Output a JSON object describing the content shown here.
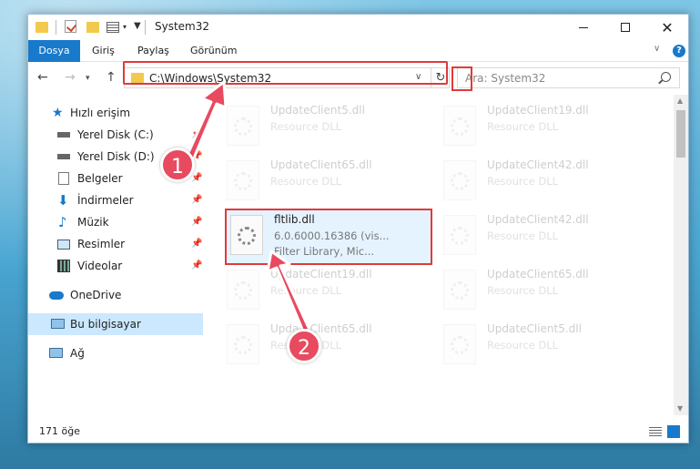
{
  "window": {
    "title": "System32",
    "controls": {
      "minimize": "—",
      "maximize": "☐",
      "close": "✕"
    }
  },
  "ribbon": {
    "tabs": [
      "Dosya",
      "Giriş",
      "Paylaş",
      "Görünüm"
    ],
    "help": "?"
  },
  "navbar": {
    "address": "C:\\Windows\\System32",
    "search_placeholder": "Ara: System32"
  },
  "sidebar": {
    "items": [
      {
        "label": "Hızlı erişim",
        "icon": "star-icon"
      },
      {
        "label": "Yerel Disk (C:)",
        "icon": "drive-icon",
        "pinned": true
      },
      {
        "label": "Yerel Disk (D:)",
        "icon": "drive-icon",
        "pinned": true
      },
      {
        "label": "Belgeler",
        "icon": "documents-icon",
        "pinned": true
      },
      {
        "label": "İndirmeler",
        "icon": "downloads-icon",
        "pinned": true
      },
      {
        "label": "Müzik",
        "icon": "music-icon",
        "pinned": true
      },
      {
        "label": "Resimler",
        "icon": "pictures-icon",
        "pinned": true
      },
      {
        "label": "Videolar",
        "icon": "videos-icon",
        "pinned": true
      },
      {
        "label": "OneDrive",
        "icon": "cloud-icon"
      },
      {
        "label": "Bu bilgisayar",
        "icon": "computer-icon",
        "selected": true
      },
      {
        "label": "Ağ",
        "icon": "network-icon"
      }
    ]
  },
  "files": [
    {
      "name": "UpdateClient5.dll",
      "desc": "Resource DLL"
    },
    {
      "name": "UpdateClient19.dll",
      "desc": "Resource DLL"
    },
    {
      "name": "UpdateClient65.dll",
      "desc": "Resource DLL"
    },
    {
      "name": "UpdateClient42.dll",
      "desc": "Resource DLL"
    },
    {
      "name": "fltlib.dll",
      "desc": "6.0.6000.16386 (vis...",
      "desc2": "Filter Library, Mic..."
    },
    {
      "name": "UpdateClient42.dll",
      "desc": "Resource DLL"
    },
    {
      "name": "UpdateClient19.dll",
      "desc": "Resource DLL"
    },
    {
      "name": "UpdateClient65.dll",
      "desc": "Resource DLL"
    },
    {
      "name": "UpdateClient65.dll",
      "desc": "Resource DLL"
    },
    {
      "name": "UpdateClient5.dll",
      "desc": "Resource DLL"
    }
  ],
  "status": {
    "count": "171 öğe"
  },
  "annotations": {
    "step1": "1",
    "step2": "2"
  },
  "colors": {
    "accent": "#1979ca",
    "highlight": "#e03a3a",
    "badge": "#e84a5f"
  }
}
